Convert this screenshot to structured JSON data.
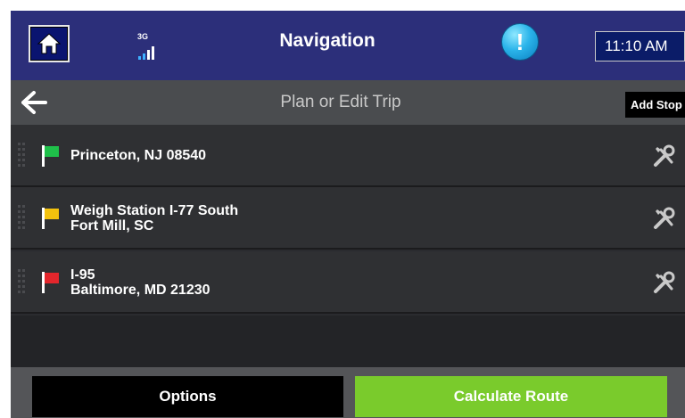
{
  "header": {
    "title": "Navigation",
    "network_label": "3G",
    "time": "11:10 AM",
    "alert_symbol": "!"
  },
  "subheader": {
    "title": "Plan or Edit Trip",
    "add_stop_label": "Add Stop"
  },
  "stops": [
    {
      "flag_color": "#1fc04a",
      "line1": "Princeton, NJ 08540",
      "line2": ""
    },
    {
      "flag_color": "#f4c20d",
      "line1": "Weigh Station I-77 South",
      "line2": "Fort Mill, SC"
    },
    {
      "flag_color": "#e3262c",
      "line1": "I-95",
      "line2": "Baltimore, MD 21230"
    }
  ],
  "footer": {
    "options_label": "Options",
    "calculate_label": "Calculate Route"
  },
  "colors": {
    "topbar": "#2c2f7a",
    "calculate_button": "#7acb2c"
  },
  "icons": {
    "home": "home-icon",
    "signal": "signal-bars-icon",
    "alert": "alert-icon",
    "back": "back-arrow-icon",
    "grip": "drag-handle-icon",
    "flag": "flag-icon",
    "edit": "tools-icon"
  }
}
